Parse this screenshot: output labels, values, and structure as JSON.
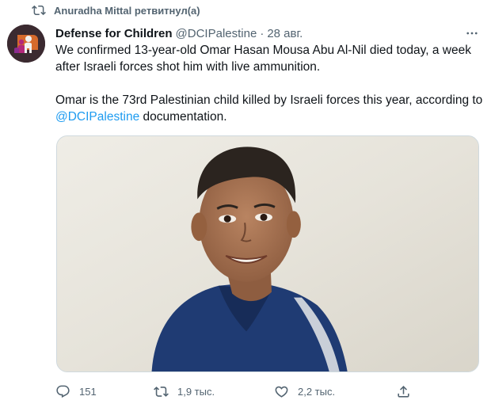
{
  "retweet": {
    "text": "Anuradha Mittal ретвитнул(а)",
    "icon": "retweet-icon"
  },
  "author": {
    "display_name": "Defense for Children",
    "handle": "@DCIPalestine",
    "separator": "·",
    "date": "28 авг."
  },
  "tweet": {
    "paragraph1": "We confirmed 13-year-old Omar Hasan Mousa Abu Al-Nil died today, a week after Israeli forces shot him with live ammunition.",
    "paragraph2_before": "Omar is the 73rd Palestinian child killed by Israeli forces this year, according to ",
    "paragraph2_mention": "@DCIPalestine",
    "paragraph2_after": " documentation."
  },
  "actions": {
    "replies": "151",
    "retweets": "1,9 тыс.",
    "likes": "2,2 тыс."
  },
  "colors": {
    "text": "#0f1419",
    "secondary": "#536471",
    "link": "#1d9bf0",
    "border": "#cfd9de"
  },
  "icons": {
    "reply": "reply-icon",
    "retweet": "retweet-icon",
    "like": "heart-icon",
    "share": "share-icon",
    "more": "more-icon"
  }
}
